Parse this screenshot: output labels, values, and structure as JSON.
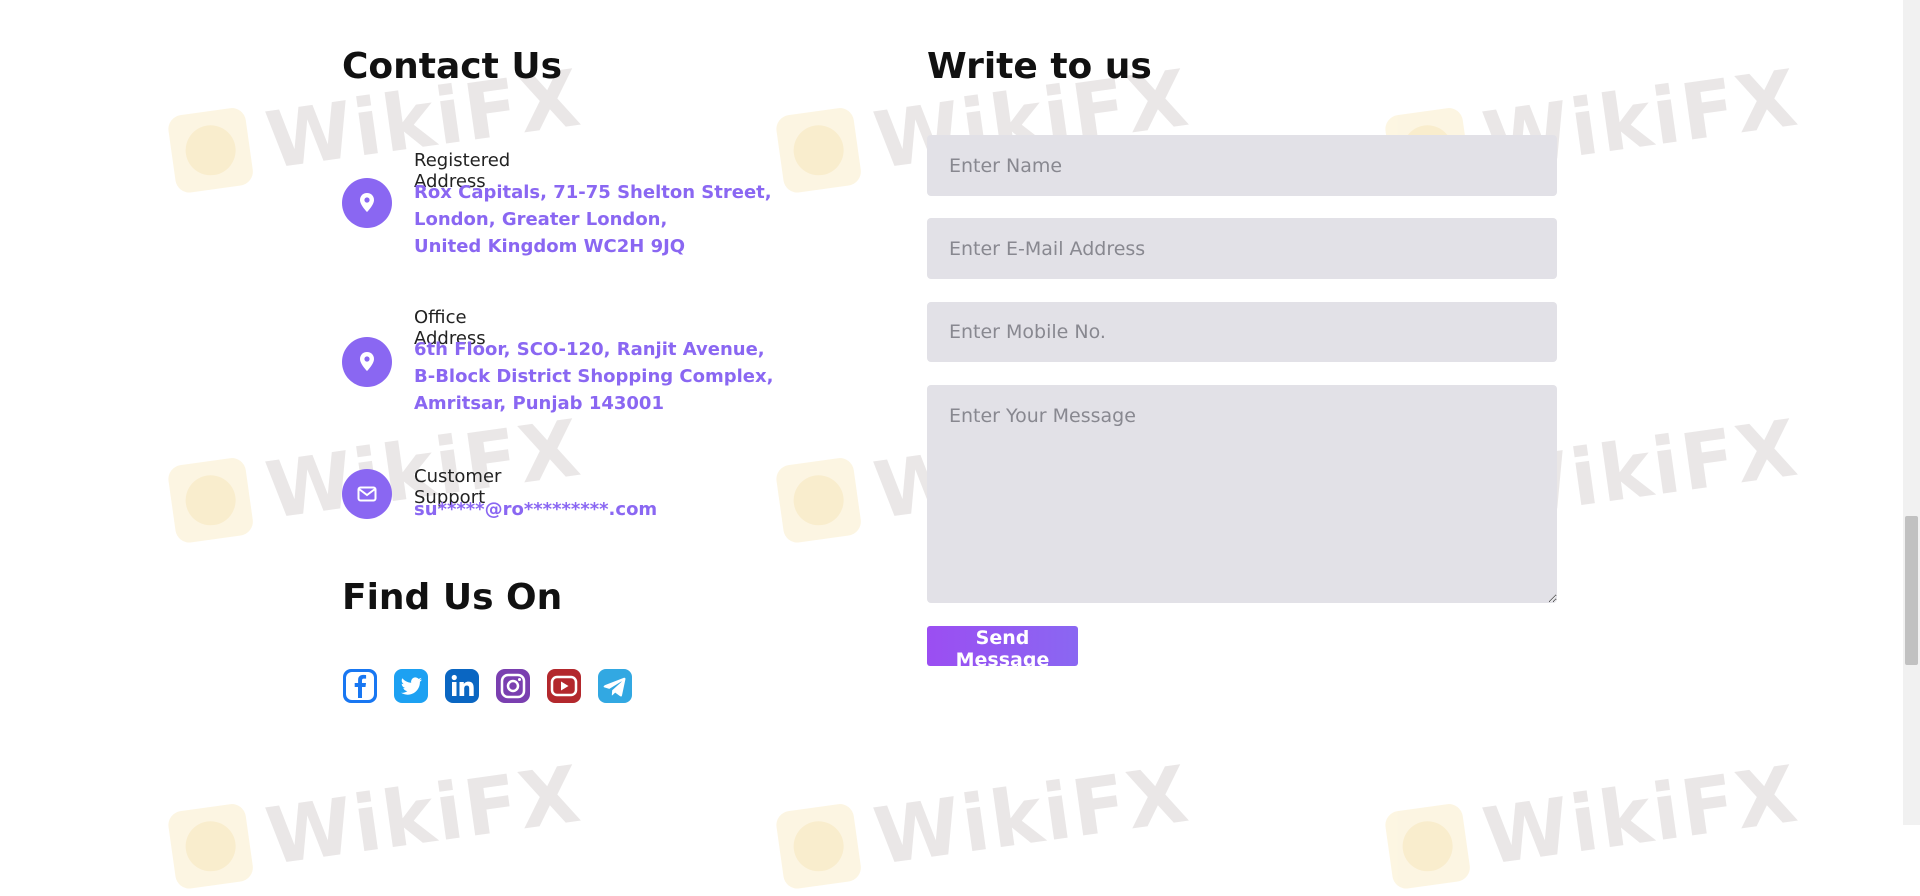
{
  "contact": {
    "title": "Contact Us",
    "registered": {
      "label": "Registered Address",
      "lines": [
        "Rox Capitals, 71-75 Shelton Street,",
        "London, Greater London,",
        "United Kingdom WC2H 9JQ"
      ]
    },
    "office": {
      "label": "Office Address",
      "lines": [
        "6th Floor, SCO-120, Ranjit Avenue,",
        "B-Block District Shopping Complex,",
        "Amritsar, Punjab 143001"
      ]
    },
    "support": {
      "label": "Customer Support",
      "email": "su*****@ro*********.com"
    }
  },
  "find": {
    "title": "Find Us On",
    "socials": [
      {
        "icon": "facebook-icon",
        "color": "#1877f2"
      },
      {
        "icon": "twitter-icon",
        "color": "#1da1f2"
      },
      {
        "icon": "linkedin-icon",
        "color": "#0a66c2"
      },
      {
        "icon": "instagram-icon",
        "color": "#7a3fb0"
      },
      {
        "icon": "youtube-icon",
        "color": "#b3282d"
      },
      {
        "icon": "telegram-icon",
        "color": "#32a8e2"
      }
    ]
  },
  "form": {
    "title": "Write to us",
    "name_placeholder": "Enter Name",
    "email_placeholder": "Enter E-Mail Address",
    "mobile_placeholder": "Enter Mobile No.",
    "message_placeholder": "Enter Your Message",
    "send_label": "Send Message"
  },
  "watermark": {
    "text": "WikiFX"
  },
  "colors": {
    "accent": "#8a67f2",
    "field_bg": "#e2e1e7"
  }
}
